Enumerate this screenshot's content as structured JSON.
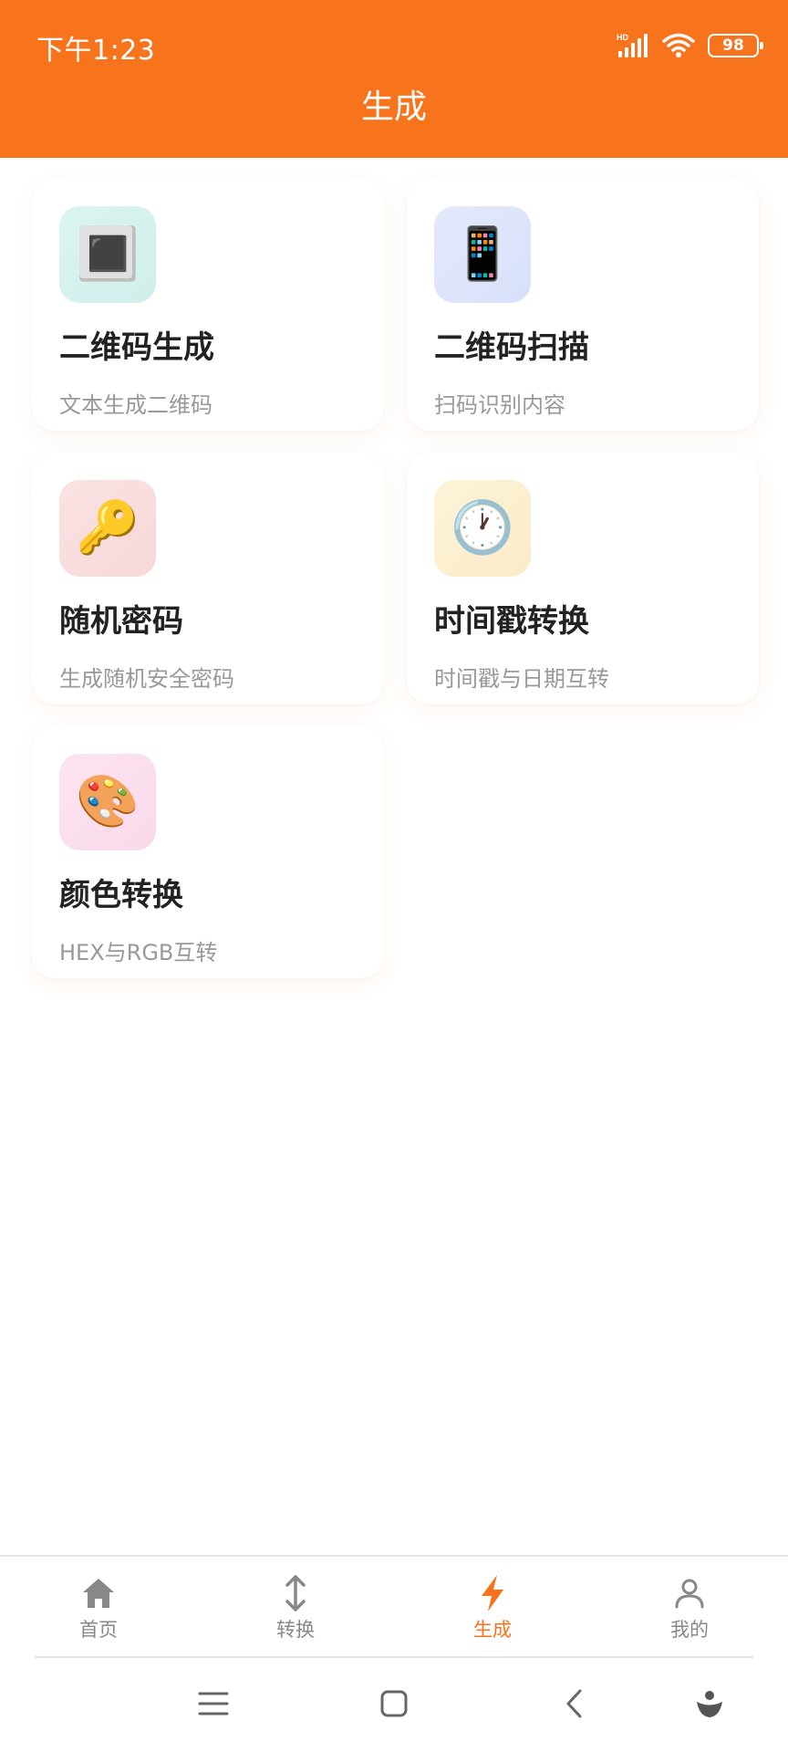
{
  "status_bar": {
    "time": "下午1:23",
    "battery": "98",
    "signal_label": "HD"
  },
  "header": {
    "title": "生成"
  },
  "cards": [
    {
      "icon": "🔳",
      "icon_name": "qr-code-icon",
      "title": "二维码生成",
      "subtitle": "文本生成二维码"
    },
    {
      "icon": "📱",
      "icon_name": "mobile-phone-icon",
      "title": "二维码扫描",
      "subtitle": "扫码识别内容"
    },
    {
      "icon": "🔑",
      "icon_name": "key-icon",
      "title": "随机密码",
      "subtitle": "生成随机安全密码"
    },
    {
      "icon": "🕐",
      "icon_name": "clock-icon",
      "title": "时间戳转换",
      "subtitle": "时间戳与日期互转"
    },
    {
      "icon": "🎨",
      "icon_name": "palette-icon",
      "title": "颜色转换",
      "subtitle": "HEX与RGB互转"
    }
  ],
  "bottom_nav": {
    "items": [
      {
        "label": "首页",
        "icon": "home-icon",
        "active": false
      },
      {
        "label": "转换",
        "icon": "swap-vertical-icon",
        "active": false
      },
      {
        "label": "生成",
        "icon": "lightning-icon",
        "active": true
      },
      {
        "label": "我的",
        "icon": "user-icon",
        "active": false
      }
    ]
  },
  "colors": {
    "accent": "#f7731c",
    "nav_inactive": "#888888",
    "title_text": "#222222",
    "subtitle_text": "#999999"
  }
}
